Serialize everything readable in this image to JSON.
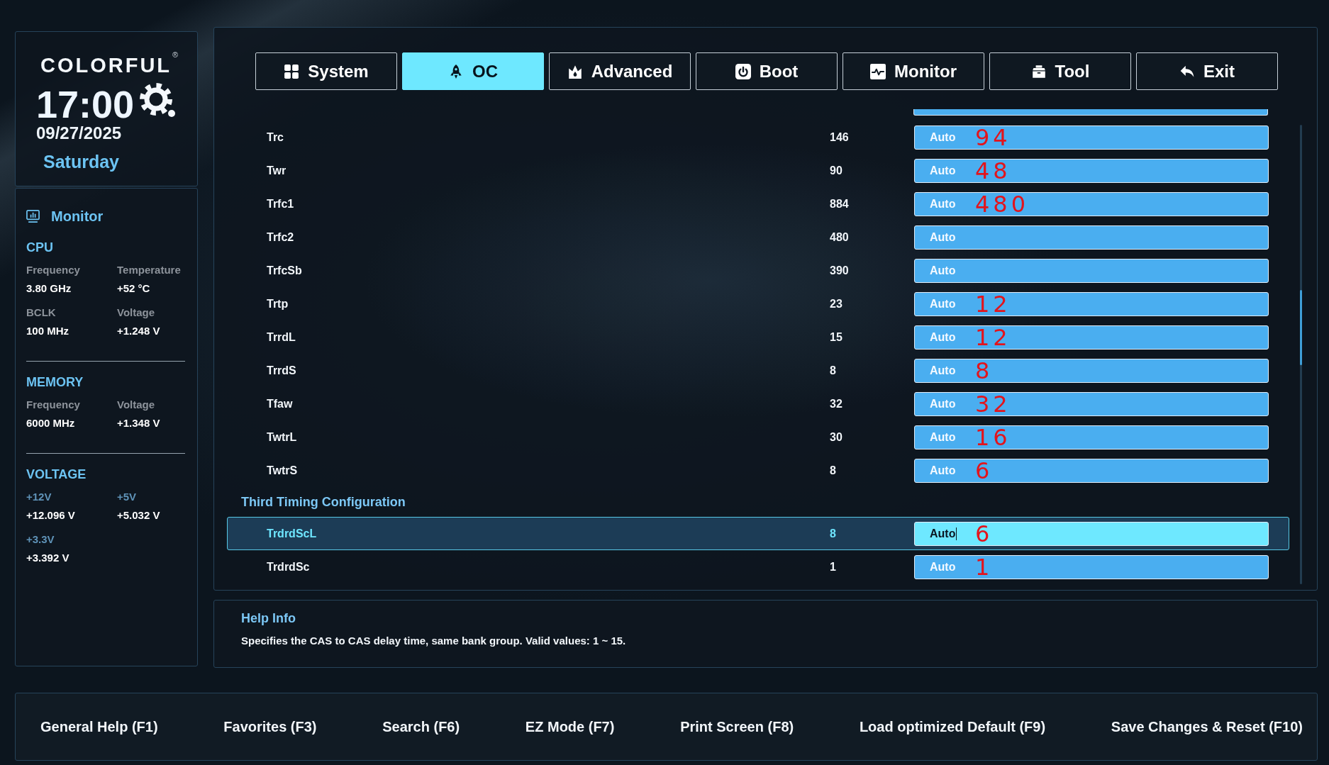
{
  "sidebar": {
    "brand": "COLORFUL",
    "brand_mark": "®",
    "time": "17:00",
    "date": "09/27/2025",
    "weekday": "Saturday",
    "monitor": {
      "title": "Monitor",
      "sections": [
        {
          "kind": "stats",
          "heading": "CPU",
          "items": [
            {
              "label": "Frequency",
              "value": "3.80 GHz"
            },
            {
              "label": "Temperature",
              "value": "+52 °C"
            },
            {
              "label": "BCLK",
              "value": "100 MHz"
            },
            {
              "label": "Voltage",
              "value": "+1.248 V"
            }
          ]
        },
        {
          "kind": "stats",
          "heading": "MEMORY",
          "items": [
            {
              "label": "Frequency",
              "value": "6000 MHz"
            },
            {
              "label": "Voltage",
              "value": "+1.348 V"
            }
          ]
        },
        {
          "kind": "rails",
          "heading": "VOLTAGE",
          "items": [
            {
              "label": "+12V",
              "value": "+12.096 V"
            },
            {
              "label": "+5V",
              "value": "+5.032 V"
            },
            {
              "label": "+3.3V",
              "value": "+3.392 V"
            }
          ]
        }
      ]
    }
  },
  "tabs": [
    {
      "label": "System",
      "selected": false
    },
    {
      "label": "OC",
      "selected": true
    },
    {
      "label": "Advanced",
      "selected": false
    },
    {
      "label": "Boot",
      "selected": false
    },
    {
      "label": "Monitor",
      "selected": false
    },
    {
      "label": "Tool",
      "selected": false
    },
    {
      "label": "Exit",
      "selected": false
    }
  ],
  "settings": [
    {
      "kind": "row",
      "name": "Trc",
      "value": "146",
      "field": "Auto",
      "note": "94",
      "selected": false
    },
    {
      "kind": "row",
      "name": "Twr",
      "value": "90",
      "field": "Auto",
      "note": "48",
      "selected": false
    },
    {
      "kind": "row",
      "name": "Trfc1",
      "value": "884",
      "field": "Auto",
      "note": "480",
      "selected": false
    },
    {
      "kind": "row",
      "name": "Trfc2",
      "value": "480",
      "field": "Auto",
      "selected": false
    },
    {
      "kind": "row",
      "name": "TrfcSb",
      "value": "390",
      "field": "Auto",
      "selected": false
    },
    {
      "kind": "row",
      "name": "Trtp",
      "value": "23",
      "field": "Auto",
      "note": "12",
      "selected": false
    },
    {
      "kind": "row",
      "name": "TrrdL",
      "value": "15",
      "field": "Auto",
      "note": "12",
      "selected": false
    },
    {
      "kind": "row",
      "name": "TrrdS",
      "value": "8",
      "field": "Auto",
      "note": "8",
      "selected": false
    },
    {
      "kind": "row",
      "name": "Tfaw",
      "value": "32",
      "field": "Auto",
      "note": "32",
      "selected": false
    },
    {
      "kind": "row",
      "name": "TwtrL",
      "value": "30",
      "field": "Auto",
      "note": "16",
      "selected": false
    },
    {
      "kind": "row",
      "name": "TwtrS",
      "value": "8",
      "field": "Auto",
      "note": "6",
      "selected": false
    },
    {
      "kind": "heading",
      "label": "Third Timing Configuration"
    },
    {
      "kind": "row",
      "name": "TrdrdScL",
      "value": "8",
      "field": "Auto",
      "note": "6",
      "selected": true
    },
    {
      "kind": "row",
      "name": "TrdrdSc",
      "value": "1",
      "field": "Auto",
      "note": "1",
      "selected": false
    }
  ],
  "help": {
    "title": "Help Info",
    "text": "Specifies the CAS to CAS delay time, same bank group. Valid values: 1 ~ 15."
  },
  "footer": [
    "General Help (F1)",
    "Favorites (F3)",
    "Search (F6)",
    "EZ Mode (F7)",
    "Print Screen (F8)",
    "Load optimized Default (F9)",
    "Save Changes & Reset (F10)"
  ]
}
